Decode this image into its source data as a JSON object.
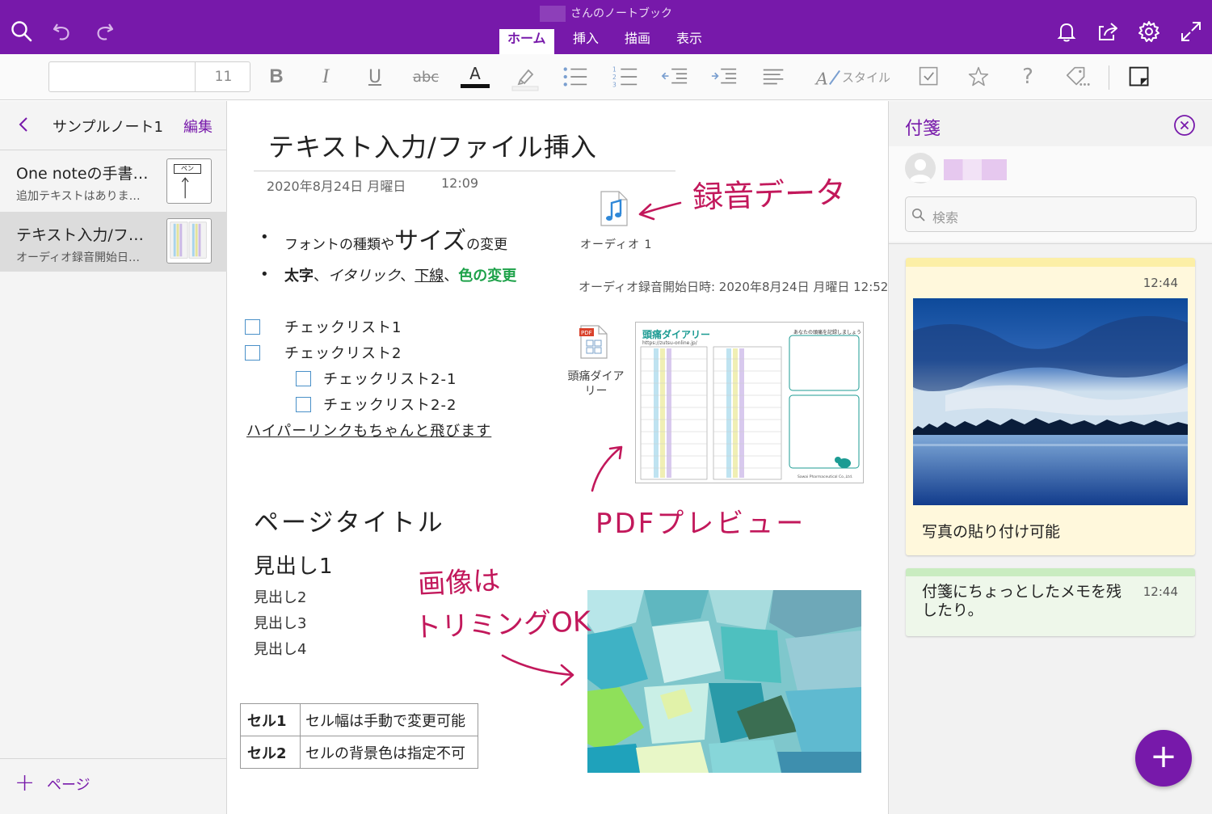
{
  "titlebar": {
    "notebook_title": "さんのノートブック",
    "tabs": [
      "ホーム",
      "挿入",
      "描画",
      "表示"
    ],
    "active_tab": "ホーム",
    "color": "#7719aa"
  },
  "ribbon": {
    "font_name": "",
    "font_size": "11",
    "bold": "B",
    "italic": "I",
    "underline": "U",
    "strike": "abc",
    "font_color": "A",
    "style_label": "スタイル",
    "question": "?"
  },
  "sidebar": {
    "back_icon": "chevron-left-icon",
    "section_title": "サンプルノート1",
    "edit_label": "編集",
    "pages": [
      {
        "title": "One noteの手書…",
        "subtitle": "追加テキストはありま…"
      },
      {
        "title": "テキスト入力/フ…",
        "subtitle": "オーディオ録音開始日…"
      }
    ],
    "add_page_label": "ページ",
    "thumb1_text": "ペン"
  },
  "page": {
    "title": "テキスト入力/ファイル挿入",
    "date": "2020年8月24日 月曜日",
    "time": "12:09",
    "bullet1": {
      "a": "フォントの種類や",
      "b": "サイズ",
      "c": "の変更"
    },
    "bullet2": {
      "bold": "太字",
      "sep1": "、",
      "italic": "イタリック",
      "sep2": "、",
      "underline": "下線",
      "sep3": "、",
      "color": "色の変更"
    },
    "checklist": [
      "チェックリスト1",
      "チェックリスト2",
      "チェックリスト2-1",
      "チェックリスト2-2"
    ],
    "hyperlink": "ハイパーリンクもちゃんと飛びます",
    "audio_label": "オーディオ 1",
    "audio_caption": "オーディオ録音開始日時: 2020年8月24日 月曜日 12:52",
    "pdf_label_1": "頭痛ダイア",
    "pdf_label_2": "リー",
    "pdf_preview": {
      "title": "頭痛ダイアリー",
      "url": "https://zutsu-online.jp/",
      "right_heading": "あなたの頭痛を記録しましょう",
      "footer": "Sawai Pharmaceutical Co.,Ltd."
    },
    "outline_title": "ページタイトル",
    "heading1": "見出し1",
    "heading2": "見出し2",
    "heading3": "見出し3",
    "heading4": "見出し4",
    "table": [
      [
        "セル1",
        "セル幅は手動で変更可能"
      ],
      [
        "セル2",
        "セルの背景色は指定不可"
      ]
    ],
    "ink": {
      "recording_data": "録音データ",
      "pdf_preview": "PDFプレビュー",
      "image_trim_1": "画像は",
      "image_trim_2": "トリミングOK",
      "color": "#c2185b"
    },
    "link_color": "#1ea24a"
  },
  "sticky": {
    "header": "付箋",
    "search_placeholder": "検索",
    "notes": [
      {
        "time": "12:44",
        "text": "写真の貼り付け可能",
        "color": "#fff8dc",
        "bar": "#fcefa6"
      },
      {
        "time": "12:44",
        "text": "付箋にちょっとしたメモを残したり。",
        "color": "#eef7ea",
        "bar": "#c9ecc0"
      }
    ],
    "fab": "+"
  }
}
